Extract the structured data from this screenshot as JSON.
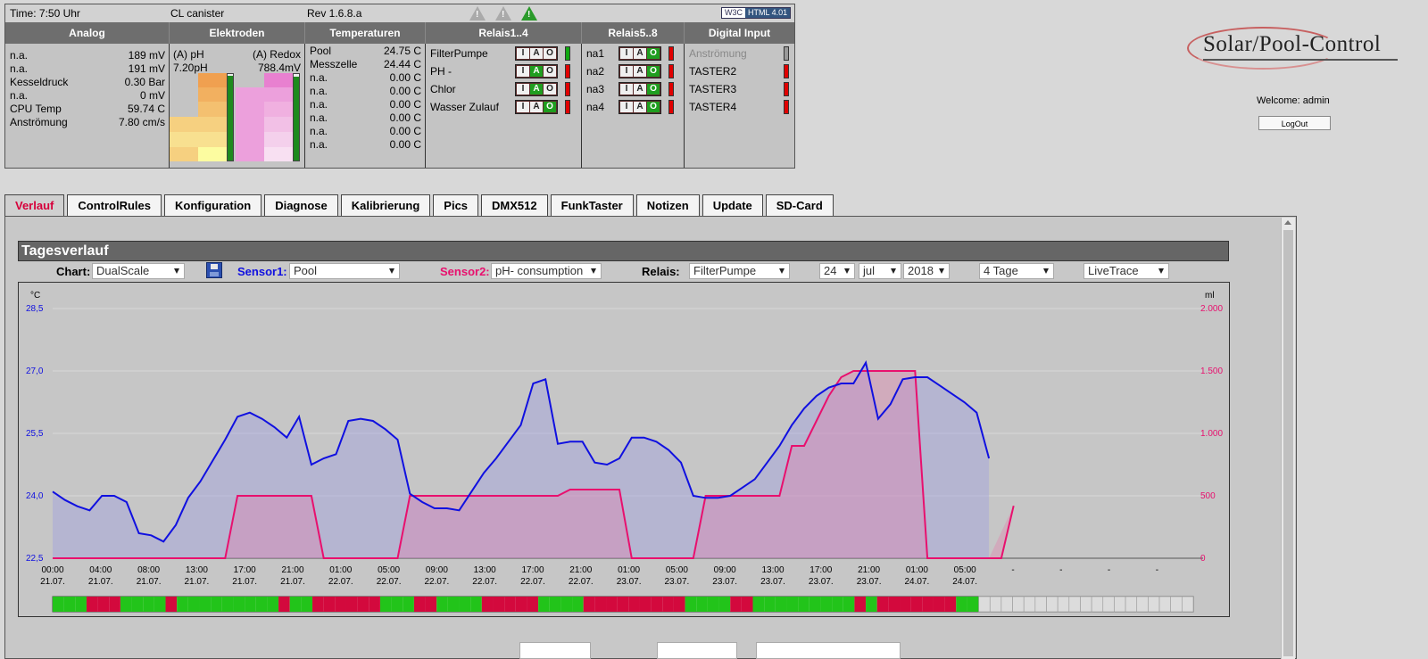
{
  "status": {
    "time": "Time: 7:50 Uhr",
    "name": "CL canister",
    "rev": "Rev 1.6.8.a",
    "validator_left": "W3C",
    "validator_right": "HTML 4.01"
  },
  "headers": [
    "Analog",
    "Elektroden",
    "Temperaturen",
    "Relais1..4",
    "Relais5..8",
    "Digital Input"
  ],
  "analog": [
    {
      "label": "n.a.",
      "value": "189 mV"
    },
    {
      "label": "n.a.",
      "value": "191 mV"
    },
    {
      "label": "Kesseldruck",
      "value": "0.30 Bar"
    },
    {
      "label": "n.a.",
      "value": "0 mV"
    },
    {
      "label": "CPU Temp",
      "value": "59.74 C"
    },
    {
      "label": "Anströmung",
      "value": "7.80 cm/s"
    }
  ],
  "electrodes": {
    "ph_label": "(A) pH",
    "redox_label": "(A) Redox",
    "ph_value": "7.20pH",
    "redox_value": "788.4mV",
    "ph_level": 0.98,
    "redox_level": 0.97
  },
  "temperatures": [
    {
      "label": "Pool",
      "value": "24.75 C"
    },
    {
      "label": "Messzelle",
      "value": "24.44 C"
    },
    {
      "label": "n.a.",
      "value": "0.00 C"
    },
    {
      "label": "n.a.",
      "value": "0.00 C"
    },
    {
      "label": "n.a.",
      "value": "0.00 C"
    },
    {
      "label": "n.a.",
      "value": "0.00 C"
    },
    {
      "label": "n.a.",
      "value": "0.00 C"
    },
    {
      "label": "n.a.",
      "value": "0.00 C"
    }
  ],
  "iao": {
    "i": "I",
    "a": "A",
    "o": "O"
  },
  "relais1": [
    {
      "label": "FilterPumpe",
      "state": "on"
    },
    {
      "label": "PH -",
      "state": "off"
    },
    {
      "label": "Chlor",
      "state": "off"
    },
    {
      "label": "Wasser Zulauf",
      "state": "off"
    }
  ],
  "relais2": [
    {
      "label": "na1",
      "state": "off"
    },
    {
      "label": "na2",
      "state": "off"
    },
    {
      "label": "na3",
      "state": "off"
    },
    {
      "label": "na4",
      "state": "off"
    }
  ],
  "digital": [
    {
      "label": "Anströmung",
      "state": "disabled"
    },
    {
      "label": "TASTER2",
      "state": "off"
    },
    {
      "label": "TASTER3",
      "state": "off"
    },
    {
      "label": "TASTER4",
      "state": "off"
    }
  ],
  "logo": "Solar/Pool-Control",
  "welcome": "Welcome:  admin",
  "logout": "LogOut",
  "tabs": [
    "Verlauf",
    "ControlRules",
    "Konfiguration",
    "Diagnose",
    "Kalibrierung",
    "Pics",
    "DMX512",
    "FunkTaster",
    "Notizen",
    "Update",
    "SD-Card"
  ],
  "active_tab": "Verlauf",
  "section_title": "Tagesverlauf",
  "controls": {
    "chart_label": "Chart:",
    "chart_value": "DualScale",
    "sensor1_label": "Sensor1:",
    "sensor1_value": "Pool",
    "sensor2_label": "Sensor2:",
    "sensor2_value": "pH- consumption",
    "relais_label": "Relais:",
    "relais_value": "FilterPumpe",
    "day": "24",
    "month": "jul",
    "year": "2018",
    "range": "4 Tage",
    "mode": "LiveTrace"
  },
  "colors": {
    "sensor1": "#1010e0",
    "sensor2": "#e8106e",
    "relay_on": "#22c41a",
    "relay_off": "#d3093d",
    "relay_none": "#dcdcdc"
  },
  "chart_data": {
    "type": "line",
    "left_unit": "°C",
    "right_unit": "ml",
    "y_left": {
      "min": 22.5,
      "max": 28.5,
      "ticks": [
        "22,5",
        "24,0",
        "25,5",
        "27,0",
        "28,5"
      ]
    },
    "y_right": {
      "min": 0,
      "max": 2000,
      "ticks": [
        "0",
        "500",
        "1.000",
        "1.500",
        "2.000"
      ]
    },
    "x_tick_times": [
      "00:00",
      "04:00",
      "08:00",
      "13:00",
      "17:00",
      "21:00",
      "01:00",
      "05:00",
      "09:00",
      "13:00",
      "17:00",
      "21:00",
      "01:00",
      "05:00",
      "-",
      "-",
      "-",
      "-"
    ],
    "x_tick_dates": [
      "21.07.",
      "21.07.",
      "21.07.",
      "21.07.",
      "21.07.",
      "21.07.",
      "22.07.",
      "22.07.",
      "22.07.",
      "22.07.",
      "22.07.",
      "22.07.",
      "23.07.",
      "23.07.",
      "23.07.",
      "23.07.",
      "23.07.",
      "23.07.",
      "24.07.",
      "24.07."
    ],
    "x_ticks": [
      {
        "time": "00:00",
        "date": "21.07."
      },
      {
        "time": "04:00",
        "date": "21.07."
      },
      {
        "time": "08:00",
        "date": "21.07."
      },
      {
        "time": "13:00",
        "date": "21.07."
      },
      {
        "time": "17:00",
        "date": "21.07."
      },
      {
        "time": "21:00",
        "date": "21.07."
      },
      {
        "time": "01:00",
        "date": "22.07."
      },
      {
        "time": "05:00",
        "date": "22.07."
      },
      {
        "time": "09:00",
        "date": "22.07."
      },
      {
        "time": "13:00",
        "date": "22.07."
      },
      {
        "time": "17:00",
        "date": "22.07."
      },
      {
        "time": "21:00",
        "date": "22.07."
      },
      {
        "time": "01:00",
        "date": "23.07."
      },
      {
        "time": "05:00",
        "date": "23.07."
      },
      {
        "time": "09:00",
        "date": "23.07."
      },
      {
        "time": "13:00",
        "date": "23.07."
      },
      {
        "time": "17:00",
        "date": "23.07."
      },
      {
        "time": "21:00",
        "date": "23.07."
      },
      {
        "time": "01:00",
        "date": "24.07."
      },
      {
        "time": "05:00",
        "date": "24.07."
      },
      {
        "time": "-",
        "date": ""
      },
      {
        "time": "-",
        "date": ""
      },
      {
        "time": "-",
        "date": ""
      },
      {
        "time": "-",
        "date": ""
      }
    ],
    "series": [
      {
        "name": "Pool",
        "axis": "left",
        "values": [
          24.1,
          23.9,
          23.75,
          23.65,
          24.0,
          24.0,
          23.85,
          23.1,
          23.05,
          22.9,
          23.3,
          23.95,
          24.35,
          24.85,
          25.35,
          25.9,
          26.0,
          25.85,
          25.65,
          25.4,
          25.9,
          24.75,
          24.9,
          25.0,
          25.8,
          25.85,
          25.8,
          25.6,
          25.35,
          24.05,
          23.85,
          23.7,
          23.7,
          23.65,
          24.1,
          24.55,
          24.9,
          25.3,
          25.7,
          26.7,
          26.8,
          25.25,
          25.3,
          25.3,
          24.8,
          24.75,
          24.9,
          25.4,
          25.4,
          25.3,
          25.1,
          24.8,
          24.0,
          23.95,
          23.95,
          24.0,
          24.2,
          24.4,
          24.8,
          25.2,
          25.7,
          26.1,
          26.4,
          26.6,
          26.7,
          26.7,
          27.2,
          25.85,
          26.2,
          26.8,
          26.85,
          26.85,
          26.65,
          26.45,
          26.25,
          26.0,
          24.9
        ]
      },
      {
        "name": "pH- consumption",
        "axis": "right",
        "values": [
          0,
          0,
          0,
          0,
          0,
          0,
          0,
          0,
          0,
          0,
          0,
          0,
          0,
          0,
          0,
          500,
          500,
          500,
          500,
          500,
          500,
          500,
          0,
          0,
          0,
          0,
          0,
          0,
          0,
          500,
          500,
          500,
          500,
          500,
          500,
          500,
          500,
          500,
          500,
          500,
          500,
          500,
          550,
          550,
          550,
          550,
          550,
          0,
          0,
          0,
          0,
          0,
          0,
          500,
          500,
          500,
          500,
          500,
          500,
          500,
          900,
          900,
          1100,
          1300,
          1450,
          1500,
          1500,
          1500,
          1500,
          1500,
          1500,
          0,
          0,
          0,
          0,
          0,
          0,
          0,
          420
        ]
      }
    ],
    "relay_bar": "GGGRRRGGGGRGGGGGGGGGRGGRRRRRRGGGRRGGGGRRRRRGGGGRRRRRRRRRGGGGRRGGGGGGGGGRGRRRRRRRGG..................."
  }
}
